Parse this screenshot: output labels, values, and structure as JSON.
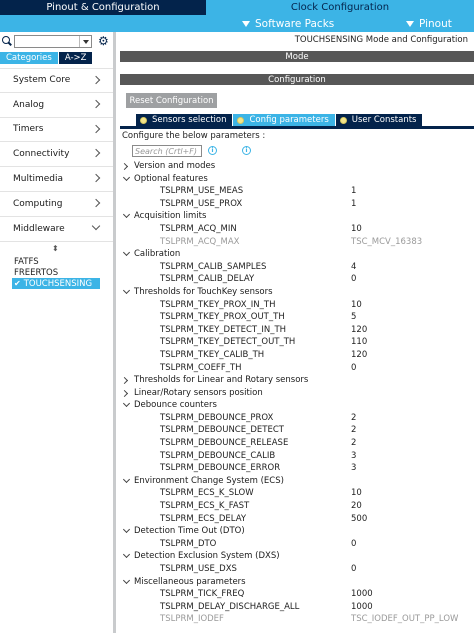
{
  "header": {
    "tabs": [
      {
        "label": "Pinout & Configuration",
        "active": true
      },
      {
        "label": "Clock Configuration",
        "active": false
      }
    ],
    "subbar": {
      "software_packs": "Software Packs",
      "pinout": "Pinout"
    }
  },
  "sidebar": {
    "search": {
      "value": "",
      "placeholder": ""
    },
    "tabs": [
      {
        "label": "Categories",
        "active": true
      },
      {
        "label": "A->Z",
        "active": false
      }
    ],
    "categories": [
      {
        "label": "System Core",
        "expanded": false
      },
      {
        "label": "Analog",
        "expanded": false
      },
      {
        "label": "Timers",
        "expanded": false
      },
      {
        "label": "Connectivity",
        "expanded": false
      },
      {
        "label": "Multimedia",
        "expanded": false
      },
      {
        "label": "Computing",
        "expanded": false
      },
      {
        "label": "Middleware",
        "expanded": true
      }
    ],
    "middleware_items": [
      {
        "label": "FATFS",
        "selected": false
      },
      {
        "label": "FREERTOS",
        "selected": false
      },
      {
        "label": "TOUCHSENSING",
        "selected": true
      }
    ]
  },
  "main": {
    "title": "TOUCHSENSING Mode and Configuration",
    "mode_header": "Mode",
    "config_header": "Configuration",
    "reset_button": "Reset Configuration",
    "tabs": [
      {
        "label": "Sensors selection",
        "active": false
      },
      {
        "label": "Config parameters",
        "active": true
      },
      {
        "label": "User Constants",
        "active": false
      }
    ],
    "configure_label": "Configure the below parameters :",
    "param_search": {
      "placeholder": "Search (Crtl+F)"
    },
    "tree": [
      {
        "type": "group",
        "label": "Version and modes",
        "open": false
      },
      {
        "type": "group",
        "label": "Optional features",
        "open": true
      },
      {
        "type": "param",
        "label": "TSLPRM_USE_MEAS",
        "value": "1"
      },
      {
        "type": "param",
        "label": "TSLPRM_USE_PROX",
        "value": "1"
      },
      {
        "type": "group",
        "label": "Acquisition limits",
        "open": true
      },
      {
        "type": "param",
        "label": "TSLPRM_ACQ_MIN",
        "value": "10"
      },
      {
        "type": "param",
        "label": "TSLPRM_ACQ_MAX",
        "value": "TSC_MCV_16383",
        "disabled": true
      },
      {
        "type": "group",
        "label": "Calibration",
        "open": true
      },
      {
        "type": "param",
        "label": "TSLPRM_CALIB_SAMPLES",
        "value": "4"
      },
      {
        "type": "param",
        "label": "TSLPRM_CALIB_DELAY",
        "value": "0"
      },
      {
        "type": "group",
        "label": "Thresholds for TouchKey sensors",
        "open": true
      },
      {
        "type": "param",
        "label": "TSLPRM_TKEY_PROX_IN_TH",
        "value": "10"
      },
      {
        "type": "param",
        "label": "TSLPRM_TKEY_PROX_OUT_TH",
        "value": "5"
      },
      {
        "type": "param",
        "label": "TSLPRM_TKEY_DETECT_IN_TH",
        "value": "120"
      },
      {
        "type": "param",
        "label": "TSLPRM_TKEY_DETECT_OUT_TH",
        "value": "110"
      },
      {
        "type": "param",
        "label": "TSLPRM_TKEY_CALIB_TH",
        "value": "120"
      },
      {
        "type": "param",
        "label": "TSLPRM_COEFF_TH",
        "value": "0"
      },
      {
        "type": "group",
        "label": "Thresholds for Linear and Rotary sensors",
        "open": false
      },
      {
        "type": "group",
        "label": "Linear/Rotary sensors position",
        "open": false
      },
      {
        "type": "group",
        "label": "Debounce counters",
        "open": true
      },
      {
        "type": "param",
        "label": "TSLPRM_DEBOUNCE_PROX",
        "value": "2"
      },
      {
        "type": "param",
        "label": "TSLPRM_DEBOUNCE_DETECT",
        "value": "2"
      },
      {
        "type": "param",
        "label": "TSLPRM_DEBOUNCE_RELEASE",
        "value": "2"
      },
      {
        "type": "param",
        "label": "TSLPRM_DEBOUNCE_CALIB",
        "value": "3"
      },
      {
        "type": "param",
        "label": "TSLPRM_DEBOUNCE_ERROR",
        "value": "3"
      },
      {
        "type": "group",
        "label": "Environment Change System (ECS)",
        "open": true
      },
      {
        "type": "param",
        "label": "TSLPRM_ECS_K_SLOW",
        "value": "10"
      },
      {
        "type": "param",
        "label": "TSLPRM_ECS_K_FAST",
        "value": "20"
      },
      {
        "type": "param",
        "label": "TSLPRM_ECS_DELAY",
        "value": "500"
      },
      {
        "type": "group",
        "label": "Detection Time Out (DTO)",
        "open": true
      },
      {
        "type": "param",
        "label": "TSLPRM_DTO",
        "value": "0"
      },
      {
        "type": "group",
        "label": "Detection Exclusion System (DXS)",
        "open": true
      },
      {
        "type": "param",
        "label": "TSLPRM_USE_DXS",
        "value": "0"
      },
      {
        "type": "group",
        "label": "Miscellaneous parameters",
        "open": true
      },
      {
        "type": "param",
        "label": "TSLPRM_TICK_FREQ",
        "value": "1000"
      },
      {
        "type": "param",
        "label": "TSLPRM_DELAY_DISCHARGE_ALL",
        "value": "1000"
      },
      {
        "type": "param",
        "label": "TSLPRM_IODEF",
        "value": "TSC_IODEF_OUT_PP_LOW",
        "disabled": true
      }
    ]
  },
  "colors": {
    "dark_blue": "#03234b",
    "light_blue": "#3cb4e6",
    "gray_bar": "#575757"
  }
}
